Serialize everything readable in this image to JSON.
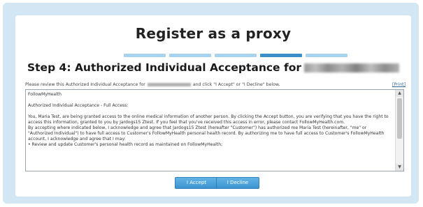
{
  "page": {
    "title": "Register as a proxy",
    "step_title": "Step 4: Authorized Individual Acceptance for"
  },
  "progress": {
    "total_steps": 5,
    "current_step": 4
  },
  "instruction": {
    "before": "Please review this Authorized Individual Acceptance for",
    "after": "and click \"I Accept\" or \"I Decline\" below.",
    "print_label": "[Print]"
  },
  "agreement": {
    "heading": "FollowMyHealth",
    "subheading": "Authorized Individual Acceptance - Full Access:",
    "paragraph1": "You, Maria Test, are being granted access to the online medical information of another person. By clicking the Accept button, you are verifying that you have the right to access this information, granted to you by Jardogs15 Ztest. If you feel that you've received this access in error, please contact FollowMyHealth.com.",
    "paragraph2": "By accepting where indicated below, I acknowledge and agree that Jardogs15 Ztest (hereafter \"Customer\") has authorized me Maria Test (hereinafter, \"me\" or \"Authorized Individual\") to have full access to Customer's FollowMyHealth personal health record. By authorizing me to have full access to Customer's FollowMyHealth account, I acknowledge and agree that I may:",
    "bullet1": "•     Review and update Customer's personal health record as maintained on FollowMyHealth;"
  },
  "buttons": {
    "accept": "I Accept",
    "decline": "I Decline"
  },
  "colors": {
    "frame_background": "#d2e7f3",
    "step_bar": "#a8d3ee",
    "step_bar_active": "#3b8fc9",
    "button": "#4aa3dc"
  },
  "icons": {
    "scroll_up": "triangle-up",
    "scroll_down": "triangle-down"
  }
}
